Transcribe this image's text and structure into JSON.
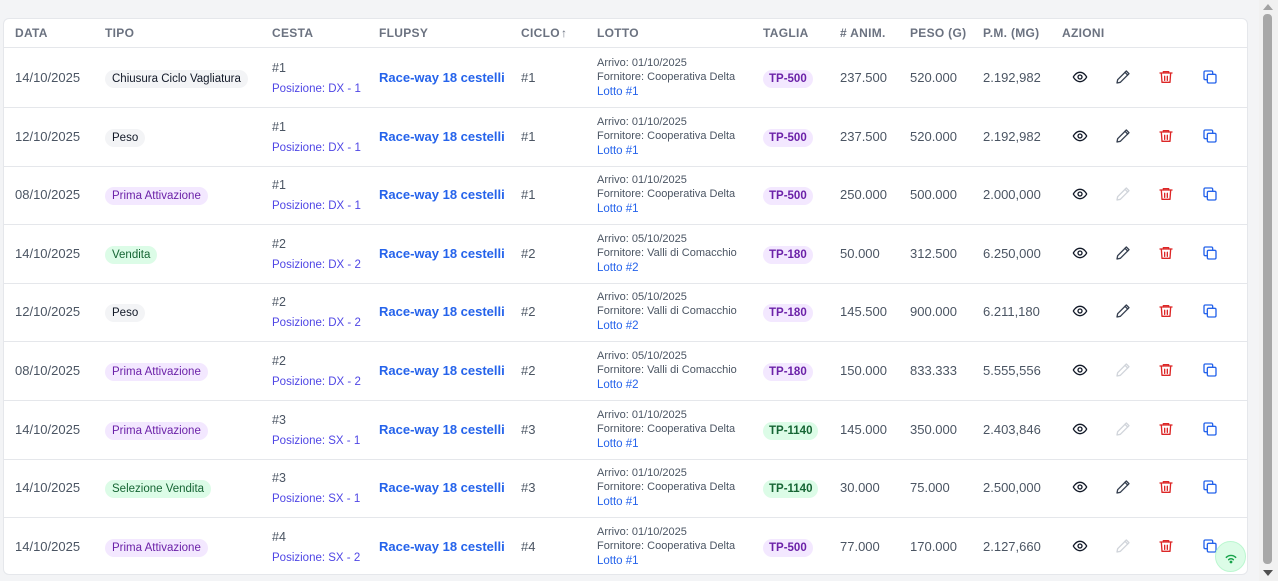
{
  "headers": {
    "data": "DATA",
    "tipo": "TIPO",
    "cesta": "CESTA",
    "flupsy": "FLUPSY",
    "ciclo": "CICLO",
    "sort_arrow": "↑",
    "lotto": "LOTTO",
    "taglia": "TAGLIA",
    "animali": "# ANIM.",
    "peso": "PESO (G)",
    "pm": "P.M. (MG)",
    "azioni": "AZIONI"
  },
  "rows": [
    {
      "data": "14/10/2025",
      "tipo": "Chiusura Ciclo Vagliatura",
      "tipo_color": "gray",
      "cesta": "#1",
      "posizione": "Posizione: DX - 1",
      "flupsy": "Race-way 18 cestelli",
      "ciclo": "#1",
      "arrivo": "Arrivo: 01/10/2025",
      "fornitore": "Fornitore: Cooperativa Delta",
      "lotto": "Lotto #1",
      "taglia": "TP-500",
      "taglia_color": "purple",
      "animali": "237.500",
      "peso": "520.000",
      "pm": "2.192,982",
      "edit_enabled": true
    },
    {
      "data": "12/10/2025",
      "tipo": "Peso",
      "tipo_color": "gray",
      "cesta": "#1",
      "posizione": "Posizione: DX - 1",
      "flupsy": "Race-way 18 cestelli",
      "ciclo": "#1",
      "arrivo": "Arrivo: 01/10/2025",
      "fornitore": "Fornitore: Cooperativa Delta",
      "lotto": "Lotto #1",
      "taglia": "TP-500",
      "taglia_color": "purple",
      "animali": "237.500",
      "peso": "520.000",
      "pm": "2.192,982",
      "edit_enabled": true
    },
    {
      "data": "08/10/2025",
      "tipo": "Prima Attivazione",
      "tipo_color": "purple",
      "cesta": "#1",
      "posizione": "Posizione: DX - 1",
      "flupsy": "Race-way 18 cestelli",
      "ciclo": "#1",
      "arrivo": "Arrivo: 01/10/2025",
      "fornitore": "Fornitore: Cooperativa Delta",
      "lotto": "Lotto #1",
      "taglia": "TP-500",
      "taglia_color": "purple",
      "animali": "250.000",
      "peso": "500.000",
      "pm": "2.000,000",
      "edit_enabled": false
    },
    {
      "data": "14/10/2025",
      "tipo": "Vendita",
      "tipo_color": "green",
      "cesta": "#2",
      "posizione": "Posizione: DX - 2",
      "flupsy": "Race-way 18 cestelli",
      "ciclo": "#2",
      "arrivo": "Arrivo: 05/10/2025",
      "fornitore": "Fornitore: Valli di Comacchio",
      "lotto": "Lotto #2",
      "taglia": "TP-180",
      "taglia_color": "purple",
      "animali": "50.000",
      "peso": "312.500",
      "pm": "6.250,000",
      "edit_enabled": true
    },
    {
      "data": "12/10/2025",
      "tipo": "Peso",
      "tipo_color": "gray",
      "cesta": "#2",
      "posizione": "Posizione: DX - 2",
      "flupsy": "Race-way 18 cestelli",
      "ciclo": "#2",
      "arrivo": "Arrivo: 05/10/2025",
      "fornitore": "Fornitore: Valli di Comacchio",
      "lotto": "Lotto #2",
      "taglia": "TP-180",
      "taglia_color": "purple",
      "animali": "145.500",
      "peso": "900.000",
      "pm": "6.211,180",
      "edit_enabled": true
    },
    {
      "data": "08/10/2025",
      "tipo": "Prima Attivazione",
      "tipo_color": "purple",
      "cesta": "#2",
      "posizione": "Posizione: DX - 2",
      "flupsy": "Race-way 18 cestelli",
      "ciclo": "#2",
      "arrivo": "Arrivo: 05/10/2025",
      "fornitore": "Fornitore: Valli di Comacchio",
      "lotto": "Lotto #2",
      "taglia": "TP-180",
      "taglia_color": "purple",
      "animali": "150.000",
      "peso": "833.333",
      "pm": "5.555,556",
      "edit_enabled": false
    },
    {
      "data": "14/10/2025",
      "tipo": "Prima Attivazione",
      "tipo_color": "purple",
      "cesta": "#3",
      "posizione": "Posizione: SX - 1",
      "flupsy": "Race-way 18 cestelli",
      "ciclo": "#3",
      "arrivo": "Arrivo: 01/10/2025",
      "fornitore": "Fornitore: Cooperativa Delta",
      "lotto": "Lotto #1",
      "taglia": "TP-1140",
      "taglia_color": "green",
      "animali": "145.000",
      "peso": "350.000",
      "pm": "2.403,846",
      "edit_enabled": false
    },
    {
      "data": "14/10/2025",
      "tipo": "Selezione Vendita",
      "tipo_color": "green",
      "cesta": "#3",
      "posizione": "Posizione: SX - 1",
      "flupsy": "Race-way 18 cestelli",
      "ciclo": "#3",
      "arrivo": "Arrivo: 01/10/2025",
      "fornitore": "Fornitore: Cooperativa Delta",
      "lotto": "Lotto #1",
      "taglia": "TP-1140",
      "taglia_color": "green",
      "animali": "30.000",
      "peso": "75.000",
      "pm": "2.500,000",
      "edit_enabled": true
    },
    {
      "data": "14/10/2025",
      "tipo": "Prima Attivazione",
      "tipo_color": "purple",
      "cesta": "#4",
      "posizione": "Posizione: SX - 2",
      "flupsy": "Race-way 18 cestelli",
      "ciclo": "#4",
      "arrivo": "Arrivo: 01/10/2025",
      "fornitore": "Fornitore: Cooperativa Delta",
      "lotto": "Lotto #1",
      "taglia": "TP-500",
      "taglia_color": "purple",
      "animali": "77.000",
      "peso": "170.000",
      "pm": "2.127,660",
      "edit_enabled": false
    }
  ],
  "icons": {
    "view": "eye-icon",
    "edit": "pencil-icon",
    "delete": "trash-icon",
    "duplicate": "copy-icon",
    "status": "wifi-icon"
  },
  "colors": {
    "link": "#2563eb",
    "position": "#4f46e5",
    "delete": "#dc2626",
    "edit_enabled": "#374151",
    "edit_disabled": "#d1d5db",
    "view": "#111827",
    "online": "#16a34a"
  }
}
